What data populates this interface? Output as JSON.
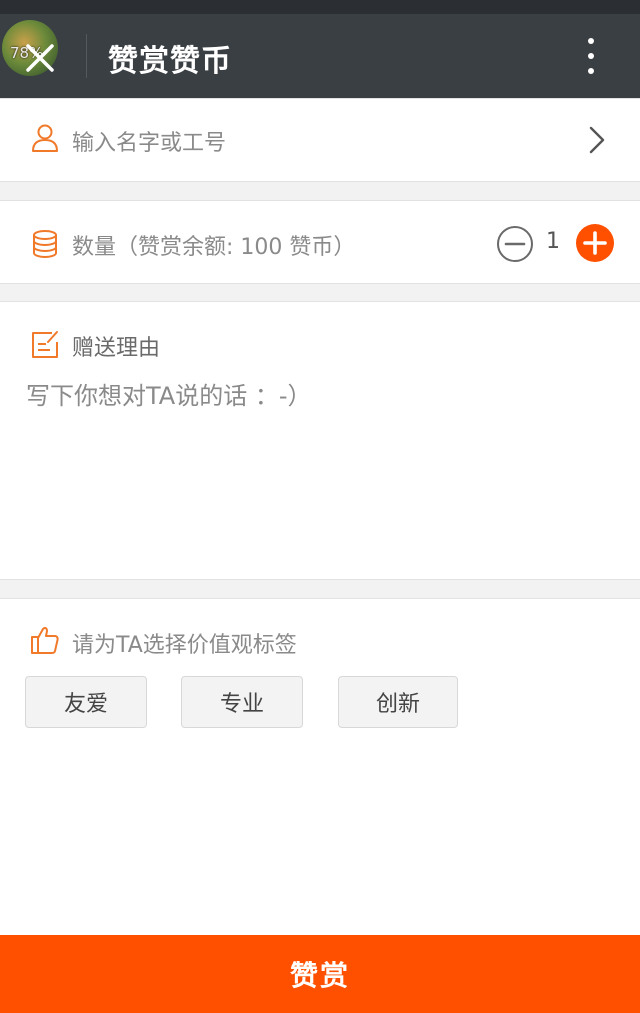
{
  "status_bar": {},
  "header": {
    "avatar_badge": "78%",
    "title": "赞赏赞币",
    "close_icon": "close-icon",
    "more_icon": "more-vertical-icon"
  },
  "recipient": {
    "icon": "person-icon",
    "placeholder": "输入名字或工号",
    "chevron_icon": "chevron-right-icon"
  },
  "quantity": {
    "icon": "coins-stack-icon",
    "label": "数量（赞赏余额: 100 赞币）",
    "value": "1",
    "minus_icon": "minus-circle-icon",
    "plus_icon": "plus-circle-icon"
  },
  "reason": {
    "icon": "edit-note-icon",
    "label": "赠送理由",
    "placeholder": "写下你想对TA说的话 ：-）"
  },
  "tags": {
    "icon": "thumbs-up-icon",
    "label": "请为TA选择价值观标签",
    "options": [
      "友爱",
      "专业",
      "创新"
    ]
  },
  "submit": {
    "label": "赞赏"
  },
  "colors": {
    "accent": "#ff5000",
    "header_bg": "#3a3f44",
    "icon_orange": "#f07a2a"
  }
}
